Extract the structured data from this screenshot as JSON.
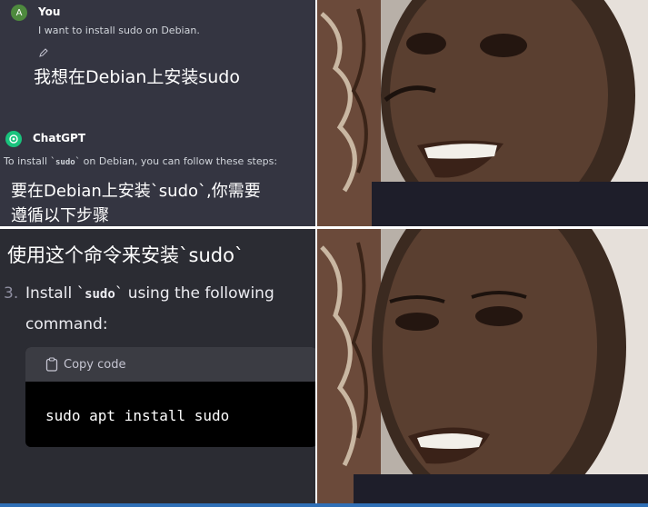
{
  "user": {
    "name": "You",
    "avatar_letter": "A",
    "message": "I want to install sudo on Debian.",
    "translation": "我想在Debian上安装sudo"
  },
  "assistant": {
    "name": "ChatGPT",
    "message_prefix": "To install ",
    "message_code": "sudo",
    "message_suffix": " on Debian, you can follow these steps:",
    "translation_line1": "要在Debian上安装`sudo`,你需要",
    "translation_line2": "遵循以下步骤"
  },
  "step": {
    "translation": "使用这个命令来安装`sudo`",
    "number": "3.",
    "text_prefix": "Install ",
    "text_code": "sudo",
    "text_suffix": " using the following",
    "text_line2": "command:"
  },
  "code_block": {
    "copy_label": "Copy code",
    "command": "sudo apt install sudo"
  },
  "colors": {
    "chat_bg": "#343541",
    "user_avatar": "#4e8a3e",
    "gpt_avatar": "#19c37d",
    "code_bg": "#000000"
  },
  "icons": [
    "pencil-icon",
    "openai-logo-icon",
    "clipboard-icon"
  ]
}
